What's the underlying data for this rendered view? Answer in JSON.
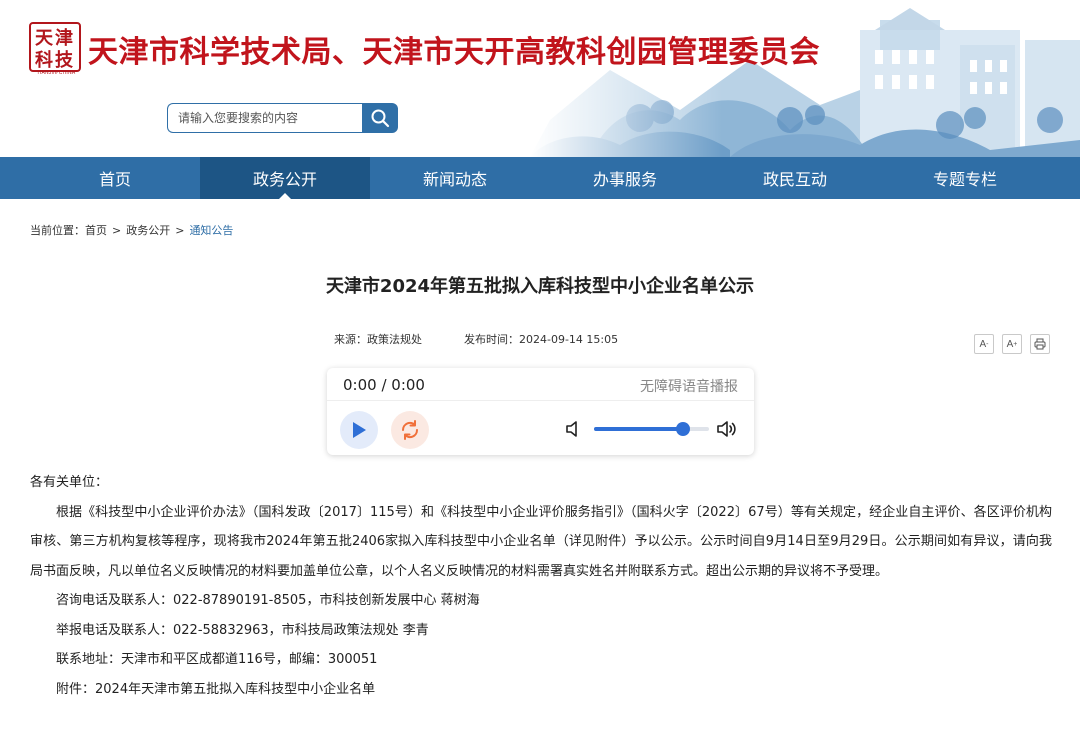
{
  "header": {
    "logo_text": "TIANJIN·CHINA",
    "site_title": "天津市科学技术局、天津市天开高教科创园管理委员会",
    "search_placeholder": "请输入您要搜索的内容"
  },
  "nav": {
    "items": [
      {
        "label": "首页"
      },
      {
        "label": "政务公开"
      },
      {
        "label": "新闻动态"
      },
      {
        "label": "办事服务"
      },
      {
        "label": "政民互动"
      },
      {
        "label": "专题专栏"
      }
    ],
    "active_index": 1,
    "color": "#2f6ea6",
    "active_color": "#1d5585"
  },
  "breadcrumb": {
    "prefix": "当前位置：",
    "items": [
      "首页",
      "政务公开",
      "通知公告"
    ],
    "separator": ">"
  },
  "article": {
    "title": "天津市2024年第五批拟入库科技型中小企业名单公示",
    "source": "来源：政策法规处",
    "publish_time": "发布时间：2024-09-14 15:05",
    "tools": {
      "font_smaller": "A",
      "font_larger": "A",
      "print_icon": "print-icon"
    },
    "salutation": "各有关单位：",
    "paragraph": "根据《科技型中小企业评价办法》（国科发政〔2017〕115号）和《科技型中小企业评价服务指引》（国科火字〔2022〕67号）等有关规定，经企业自主评价、各区评价机构审核、第三方机构复核等程序，现将我市2024年第五批2406家拟入库科技型中小企业名单（详见附件）予以公示。公示时间自9月14日至9月29日。公示期间如有异议，请向我局书面反映，凡以单位名义反映情况的材料要加盖单位公章，以个人名义反映情况的材料需署真实姓名并附联系方式。超出公示期的异议将不予受理。",
    "contact_consult": "咨询电话及联系人：022-87890191-8505，市科技创新发展中心  蒋树海",
    "contact_report": "举报电话及联系人：022-58832963，市科技局政策法规处  李青",
    "address": "联系地址：天津市和平区成都道116号，邮编：300051",
    "attachment": "附件：2024年天津市第五批拟入库科技型中小企业名单"
  },
  "player": {
    "time": "0:00 / 0:00",
    "label": "无障碍语音播报",
    "volume": 0.77,
    "accent": "#2f6fd6"
  }
}
